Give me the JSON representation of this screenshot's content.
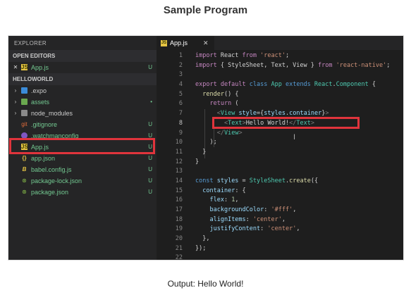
{
  "title": "Sample Program",
  "sidebar": {
    "header": "EXPLORER",
    "open_editors_label": "OPEN EDITORS",
    "open_editor": {
      "close": "✕",
      "icon": "JS",
      "name": "App.js",
      "status": "U"
    },
    "project_label": "HELLOWORLD",
    "items": [
      {
        "arrow": "›",
        "icon": "folder-blue",
        "name": ".expo",
        "status": ""
      },
      {
        "arrow": "›",
        "icon": "folder-green",
        "name": "assets",
        "status": "•"
      },
      {
        "arrow": "›",
        "icon": "folder-gray",
        "name": "node_modules",
        "status": ""
      },
      {
        "arrow": "",
        "icon": "git",
        "name": ".gitignore",
        "status": "U"
      },
      {
        "arrow": "",
        "icon": "watch",
        "name": ".watchmanconfig",
        "status": "U"
      },
      {
        "arrow": "",
        "icon": "JS",
        "name": "App.js",
        "status": "U"
      },
      {
        "arrow": "",
        "icon": "{}",
        "name": "app.json",
        "status": "U"
      },
      {
        "arrow": "",
        "icon": "B",
        "name": "babel.config.js",
        "status": "U"
      },
      {
        "arrow": "",
        "icon": "⊛",
        "name": "package-lock.json",
        "status": "U"
      },
      {
        "arrow": "",
        "icon": "⊛",
        "name": "package.json",
        "status": "U"
      }
    ]
  },
  "editor": {
    "tab": {
      "icon": "JS",
      "label": "App.js",
      "close": "✕"
    },
    "lines": [
      {
        "n": "1",
        "tokens": [
          [
            "k",
            "import "
          ],
          [
            "d",
            "React "
          ],
          [
            "k",
            "from "
          ],
          [
            "s",
            "'react'"
          ],
          [
            "d",
            ";"
          ]
        ]
      },
      {
        "n": "2",
        "tokens": [
          [
            "k",
            "import "
          ],
          [
            "d",
            "{ StyleSheet, Text, View } "
          ],
          [
            "k",
            "from "
          ],
          [
            "s",
            "'react-native'"
          ],
          [
            "d",
            ";"
          ]
        ]
      },
      {
        "n": "3",
        "tokens": []
      },
      {
        "n": "4",
        "tokens": [
          [
            "k",
            "export default "
          ],
          [
            "t",
            "class "
          ],
          [
            "n",
            "App "
          ],
          [
            "t",
            "extends "
          ],
          [
            "n",
            "React"
          ],
          [
            "d",
            "."
          ],
          [
            "n",
            "Component "
          ],
          [
            "d",
            "{"
          ]
        ]
      },
      {
        "n": "5",
        "tokens": [
          [
            "d",
            "  "
          ],
          [
            "f",
            "render"
          ],
          [
            "d",
            "() {"
          ]
        ]
      },
      {
        "n": "6",
        "tokens": [
          [
            "d",
            "    "
          ],
          [
            "k",
            "return "
          ],
          [
            "d",
            "("
          ]
        ]
      },
      {
        "n": "7",
        "tokens": [
          [
            "d",
            "      "
          ],
          [
            "g",
            "<"
          ],
          [
            "n",
            "View "
          ],
          [
            "p",
            "style"
          ],
          [
            "d",
            "={"
          ],
          [
            "p",
            "styles"
          ],
          [
            "d",
            "."
          ],
          [
            "p",
            "container"
          ],
          [
            "d",
            "}"
          ],
          [
            "g",
            ">"
          ]
        ]
      },
      {
        "n": "8",
        "tokens": [
          [
            "d",
            "        "
          ],
          [
            "g",
            "<"
          ],
          [
            "n",
            "Text"
          ],
          [
            "g",
            ">"
          ],
          [
            "w",
            "Hello World!"
          ],
          [
            "g",
            "</"
          ],
          [
            "n",
            "Text"
          ],
          [
            "g",
            ">"
          ]
        ]
      },
      {
        "n": "9",
        "tokens": [
          [
            "d",
            "      "
          ],
          [
            "g",
            "</"
          ],
          [
            "n",
            "View"
          ],
          [
            "g",
            ">"
          ]
        ]
      },
      {
        "n": "10",
        "tokens": [
          [
            "d",
            "    );"
          ]
        ]
      },
      {
        "n": "11",
        "tokens": [
          [
            "d",
            "  }"
          ]
        ]
      },
      {
        "n": "12",
        "tokens": [
          [
            "d",
            "}"
          ]
        ]
      },
      {
        "n": "13",
        "tokens": []
      },
      {
        "n": "14",
        "tokens": [
          [
            "t",
            "const "
          ],
          [
            "p",
            "styles "
          ],
          [
            "d",
            "= "
          ],
          [
            "n",
            "StyleSheet"
          ],
          [
            "d",
            "."
          ],
          [
            "f",
            "create"
          ],
          [
            "d",
            "({"
          ]
        ]
      },
      {
        "n": "15",
        "tokens": [
          [
            "d",
            "  "
          ],
          [
            "p",
            "container"
          ],
          [
            "d",
            ": {"
          ]
        ]
      },
      {
        "n": "16",
        "tokens": [
          [
            "d",
            "    "
          ],
          [
            "p",
            "flex"
          ],
          [
            "d",
            ": "
          ],
          [
            "num2",
            "1"
          ],
          [
            "d",
            ","
          ]
        ]
      },
      {
        "n": "17",
        "tokens": [
          [
            "d",
            "    "
          ],
          [
            "p",
            "backgroundColor"
          ],
          [
            "d",
            ": "
          ],
          [
            "s",
            "'#fff'"
          ],
          [
            "d",
            ","
          ]
        ]
      },
      {
        "n": "18",
        "tokens": [
          [
            "d",
            "    "
          ],
          [
            "p",
            "alignItems"
          ],
          [
            "d",
            ": "
          ],
          [
            "s",
            "'center'"
          ],
          [
            "d",
            ","
          ]
        ]
      },
      {
        "n": "19",
        "tokens": [
          [
            "d",
            "    "
          ],
          [
            "p",
            "justifyContent"
          ],
          [
            "d",
            ": "
          ],
          [
            "s",
            "'center'"
          ],
          [
            "d",
            ","
          ]
        ]
      },
      {
        "n": "20",
        "tokens": [
          [
            "d",
            "  },"
          ]
        ]
      },
      {
        "n": "21",
        "tokens": [
          [
            "d",
            "});"
          ]
        ]
      },
      {
        "n": "22",
        "tokens": []
      }
    ],
    "active_line": "8"
  },
  "output": "Output: Hello World!"
}
